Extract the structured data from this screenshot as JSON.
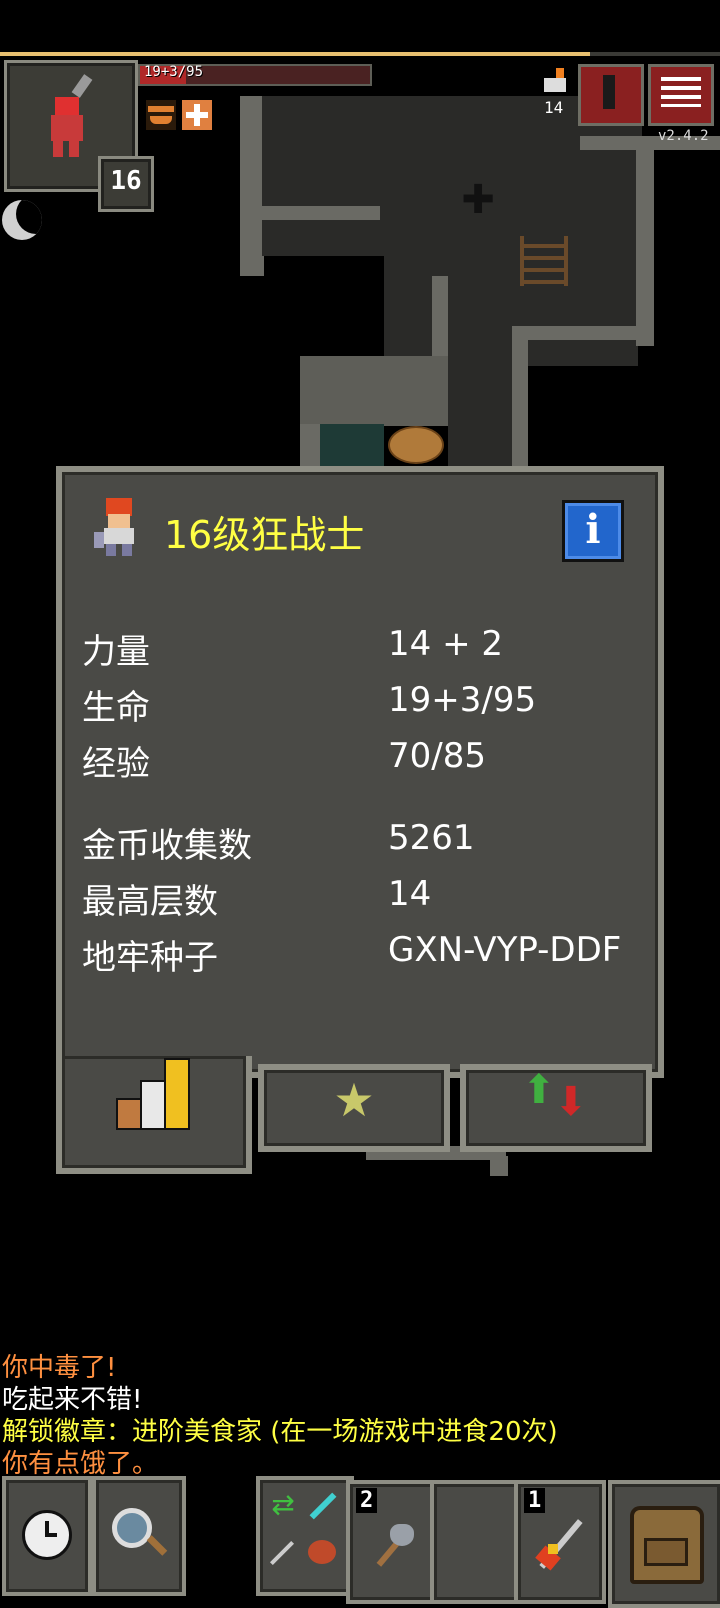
{
  "hud": {
    "hp_text": "19+3/95",
    "hp_fraction": 0.2,
    "level": "16",
    "depth": "14",
    "version": "v2.4.2",
    "xp_fraction": 0.82
  },
  "panel": {
    "title": "16级狂战士",
    "stats_primary": [
      {
        "label": "力量",
        "value": "14 + 2"
      },
      {
        "label": "生命",
        "value": "19+3/95"
      },
      {
        "label": "经验",
        "value": "70/85"
      }
    ],
    "stats_secondary": [
      {
        "label": "金币收集数",
        "value": "5261"
      },
      {
        "label": "最高层数",
        "value": "14"
      },
      {
        "label": "地牢种子",
        "value": "GXN-VYP-DDF"
      }
    ]
  },
  "quickslots": {
    "slot1_count": "2",
    "slot3_count": "1"
  },
  "log": [
    {
      "text": "你中毒了!",
      "color": "#ff9040"
    },
    {
      "text": "吃起来不错!",
      "color": "#ffffff"
    },
    {
      "text": "解锁徽章：进阶美食家 (在一场游戏中进食20次)",
      "color": "#ffff44"
    },
    {
      "text": "你有点饿了。",
      "color": "#ff9040"
    }
  ]
}
